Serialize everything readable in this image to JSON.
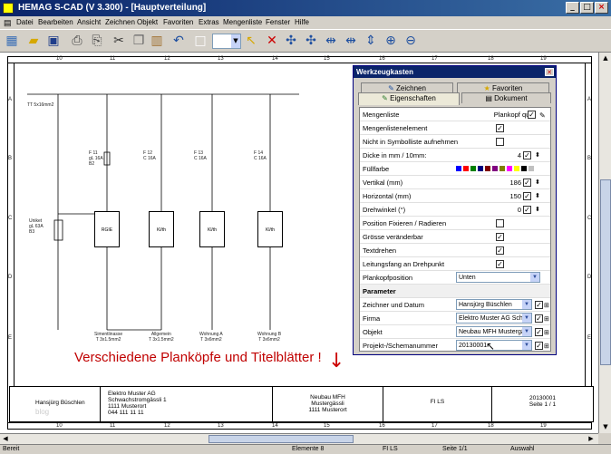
{
  "window": {
    "title": "HEMAG S-CAD (V 3.300) - [Hauptverteilung]",
    "min": "_",
    "max": "□",
    "close": "×"
  },
  "menu": [
    "Datei",
    "Bearbeiten",
    "Ansicht",
    "Zeichnen",
    "Objekt",
    "Favoriten",
    "Extras",
    "Mengenliste",
    "Fenster",
    "Hilfe"
  ],
  "toolbar": {
    "icons": [
      "drawing-icon",
      "open-folder-icon",
      "save-icon",
      "print-icon",
      "print-preview-icon",
      "cut-icon",
      "copy-icon",
      "paste-icon",
      "undo-icon",
      "blank-icon",
      "dropdown-icon",
      "pointer-icon",
      "tool-a-icon",
      "tool-b-icon",
      "tool-c-icon",
      "tool-d-icon",
      "tool-e-icon",
      "tool-f-icon",
      "zoom-in-icon",
      "zoom-out-icon"
    ]
  },
  "ruler": {
    "cols": [
      "10",
      "11",
      "12",
      "13",
      "14",
      "15",
      "16",
      "17",
      "18",
      "19"
    ],
    "rows": [
      "A",
      "B",
      "C",
      "D",
      "E"
    ]
  },
  "schematic": {
    "labels": [
      "F 11\ngL 16A\nB2",
      "F 12\nC 16A",
      "F 13\nC 16A",
      "F 14\nC 16A",
      "RGIE",
      "Kl/th",
      "Kl/th",
      "Kl/th",
      "Simentlinasse\nT 3x1.5mm2",
      "Allgemein\nT 3x1.5mm2",
      "Wohnung A\nT 3x6mm2",
      "Wohnung B\nT 3x6mm2",
      "Uniket\ngL 63A\nB3",
      "TT 5x16mm2"
    ],
    "annotation": "Verschiedene Planköpfe und Titelblätter !"
  },
  "titleblock": {
    "drawer": "Hansjürg Büschlen",
    "watermark": "blog",
    "company": "Elektro Muster AG\nSchwachstromgässli 1\n1111 Musterort\n044 111 11 11",
    "project": "Neubau MFH\nMustergässli\n1111 Musterort",
    "code": "FI LS",
    "number": "20130001\nSeite 1 / 1"
  },
  "panel": {
    "title": "Werkzeugkasten",
    "tabs": {
      "zeichnen": "Zeichnen",
      "favoriten": "Favoriten",
      "eigenschaften": "Eigenschaften",
      "dokument": "Dokument"
    },
    "rows": [
      {
        "label": "Mengenliste",
        "value": "Plankopf quer"
      },
      {
        "label": "Mengenlistenelement",
        "check": true
      },
      {
        "label": "Nicht in Symbolliste aufnehmen",
        "check": false
      },
      {
        "label": "Dicke in mm / 10mm:",
        "value": "4"
      },
      {
        "label": "Füllfarbe"
      },
      {
        "label": "Vertikal (mm)",
        "value": "186"
      },
      {
        "label": "Horizontal (mm)",
        "value": "150"
      },
      {
        "label": "Drehwinkel (°)",
        "value": "0"
      },
      {
        "label": "Position Fixieren / Radieren",
        "check": false
      },
      {
        "label": "Grösse veränderbar",
        "check": true
      },
      {
        "label": "Textdrehen",
        "check": true
      },
      {
        "label": "Leitungsfang an Drehpunkt",
        "check": true
      },
      {
        "label": "Plankopfposition",
        "value": "Unten"
      },
      {
        "label": "Parameter"
      },
      {
        "label": "Zeichner und Datum",
        "value": "Hansjürg Büschlen"
      },
      {
        "label": "Firma",
        "value": "Elektro Muster AG  Sch"
      },
      {
        "label": "Objekt",
        "value": "Neubau MFH  Mustergä"
      },
      {
        "label": "Projekt-/Schemanummer",
        "value": "20130001"
      }
    ],
    "colors": [
      "#0000ff",
      "#ff0000",
      "#008000",
      "#000080",
      "#800000",
      "#800080",
      "#808000",
      "#ff00ff",
      "#ffff00",
      "#000000",
      "#c0c0c0"
    ]
  },
  "status": {
    "ready": "Bereit",
    "elements": "Elemente 8",
    "fils": "FI LS",
    "page": "Seite 1/1",
    "mode": "Auswahl"
  }
}
